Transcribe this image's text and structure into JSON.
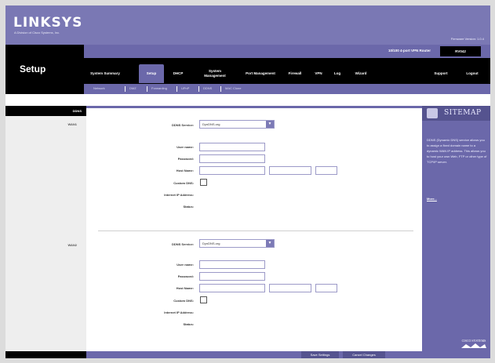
{
  "header": {
    "brand": "LINKSYS",
    "brand_sub": "A Division of Cisco Systems, Inc.",
    "firmware": "Firmware Version: 1.0.4",
    "product_name": "10/100 4-port VPN Router",
    "model": "RV042",
    "page_title": "Setup"
  },
  "nav": {
    "items": [
      {
        "label": "System Summary"
      },
      {
        "label": "Setup"
      },
      {
        "label": "DHCP"
      },
      {
        "label": "System Management"
      },
      {
        "label": "Port Management"
      },
      {
        "label": "Firewall"
      },
      {
        "label": "VPN"
      },
      {
        "label": "Log"
      },
      {
        "label": "Wizard"
      },
      {
        "label": "Support"
      },
      {
        "label": "Logout"
      }
    ],
    "subnav": [
      "Network",
      "DMZ",
      "Forwarding",
      "UPnP",
      "DDNS",
      "MAC Clone"
    ]
  },
  "section": {
    "title": "DDNS",
    "wan1_label": "WAN1",
    "wan2_label": "WAN2"
  },
  "wan1": {
    "service_label": "DDNS Service:",
    "service_value": "DynDNS.org",
    "username_label": "User name:",
    "password_label": "Password:",
    "hostname_label": "Host Name:",
    "custom_dns_label": "Custom DNS:",
    "ip_label": "Internet IP Address:",
    "status_label": "Status:"
  },
  "wan2": {
    "service_label": "DDNS Service:",
    "service_value": "DynDNS.org",
    "username_label": "User name:",
    "password_label": "Password:",
    "hostname_label": "Host Name:",
    "custom_dns_label": "Custom DNS:",
    "ip_label": "Internet IP Address:",
    "status_label": "Status:"
  },
  "sitemap": {
    "title": "SITEMAP",
    "help_text": "DDNS (Dynamic DNS) service allows you to assign a fixed domain name to a dynamic WAN IP address. This allows you to host your own Web, FTP or other type of TCP/IP server.",
    "more_link": "More...",
    "cisco_logo": "CISCO SYSTEMS"
  },
  "footer": {
    "save_label": "Save Settings",
    "cancel_label": "Cancel Changes"
  },
  "colors": {
    "accent": "#6b68aa",
    "banner": "#7a78b4",
    "nav_bg": "#000000"
  }
}
